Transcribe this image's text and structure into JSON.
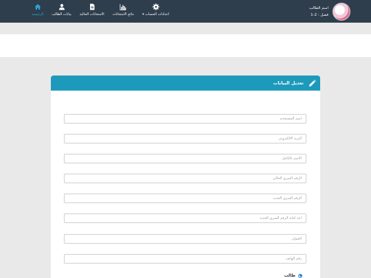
{
  "profile": {
    "name": "اسم الطالب",
    "class_label": "فصل : 2-1"
  },
  "nav": {
    "items": [
      {
        "label": "الرئيسية",
        "icon": "home-icon",
        "active": true
      },
      {
        "label": "بيانات الطالب",
        "icon": "user-icon",
        "active": false
      },
      {
        "label": "الامتحانات الحالية",
        "icon": "document-icon",
        "active": false
      },
      {
        "label": "نتائج الامتحانات",
        "icon": "bar-chart-icon",
        "active": false
      },
      {
        "label": "اعدادات الحساب ▾",
        "icon": "gear-icon",
        "active": false
      }
    ]
  },
  "card": {
    "title": "تعديل البيانات",
    "header_icon": "pencil-icon"
  },
  "form": {
    "fields": [
      {
        "placeholder": "اسم المستخدم"
      },
      {
        "placeholder": "البريد الالكتروني"
      },
      {
        "placeholder": "الاسم بالكامل"
      },
      {
        "placeholder": "الرقم السري الحالي"
      },
      {
        "placeholder": "الرقم السري الجديد"
      },
      {
        "placeholder": "اعد كتابة الرقم السري الجديد"
      },
      {
        "placeholder": "العنوان"
      },
      {
        "placeholder": "رقم الهاتف"
      }
    ],
    "radio_label": "طالب"
  },
  "colors": {
    "topbar": "#2f3e4c",
    "accent": "#1d9abb",
    "active_nav": "#2aa6d6"
  }
}
